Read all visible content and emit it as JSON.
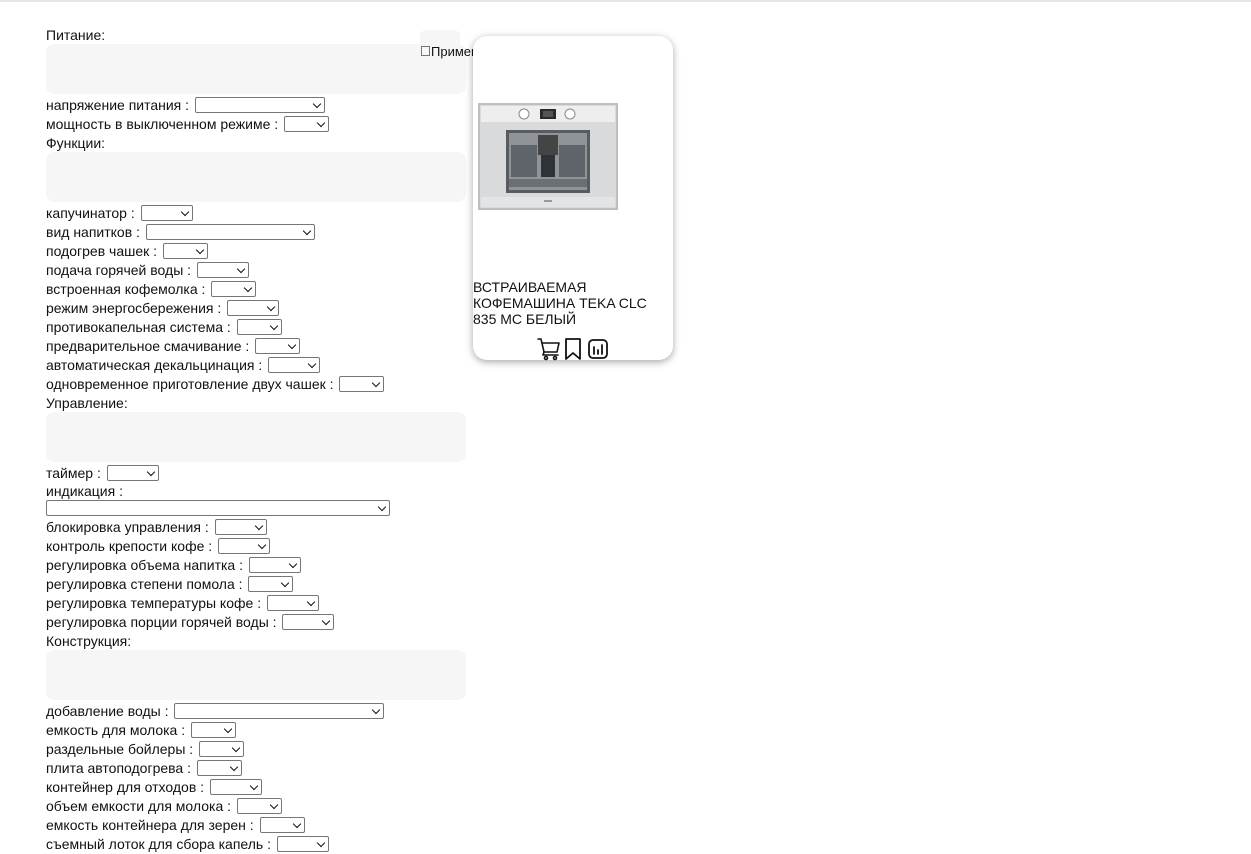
{
  "apply": {
    "label": "Применить"
  },
  "groups": {
    "power": {
      "title": "Питание:",
      "filters": [
        {
          "label": "напряжение питания :",
          "value": ""
        },
        {
          "label": "мощность в выключенном режиме :",
          "value": ""
        }
      ]
    },
    "functions": {
      "title": "Функции:",
      "filters": [
        {
          "label": "капучинатор :",
          "value": ""
        },
        {
          "label": "вид напитков :",
          "value": ""
        },
        {
          "label": "подогрев чашек :",
          "value": ""
        },
        {
          "label": "подача горячей воды :",
          "value": ""
        },
        {
          "label": "встроенная кофемолка :",
          "value": ""
        },
        {
          "label": "режим энергосбережения :",
          "value": ""
        },
        {
          "label": "противокапельная система :",
          "value": ""
        },
        {
          "label": "предварительное смачивание :",
          "value": ""
        },
        {
          "label": "автоматическая декальцинация :",
          "value": ""
        },
        {
          "label": "одновременное приготовление двух чашек :",
          "value": ""
        }
      ]
    },
    "control": {
      "title": "Управление:",
      "filters": [
        {
          "label": "таймер :",
          "value": ""
        },
        {
          "label": "индикация :",
          "value": ""
        },
        {
          "label": "блокировка управления :",
          "value": ""
        },
        {
          "label": "контроль крепости кофе :",
          "value": ""
        },
        {
          "label": "регулировка объема напитка :",
          "value": ""
        },
        {
          "label": "регулировка степени помола :",
          "value": ""
        },
        {
          "label": "регулировка температуры кофе :",
          "value": ""
        },
        {
          "label": "регулировка порции горячей воды :",
          "value": ""
        }
      ]
    },
    "construction": {
      "title": "Конструкция:",
      "filters": [
        {
          "label": "добавление воды :",
          "value": ""
        },
        {
          "label": "емкость для молока :",
          "value": ""
        },
        {
          "label": "раздельные бойлеры :",
          "value": ""
        },
        {
          "label": "плита автоподогрева :",
          "value": ""
        },
        {
          "label": "контейнер для отходов :",
          "value": ""
        },
        {
          "label": "объем емкости для молока :",
          "value": ""
        },
        {
          "label": "емкость контейнера для зерен :",
          "value": ""
        },
        {
          "label": "съемный лоток для сбора капель :",
          "value": ""
        }
      ]
    }
  },
  "product": {
    "title": "ВСТРАИВАЕМАЯ КОФЕМАШИНА TEKA CLC 835 MC БЕЛЫЙ",
    "image_icon": "coffee-machine-image",
    "actions": [
      "cart-icon",
      "bookmark-icon",
      "compare-chart-icon"
    ]
  }
}
